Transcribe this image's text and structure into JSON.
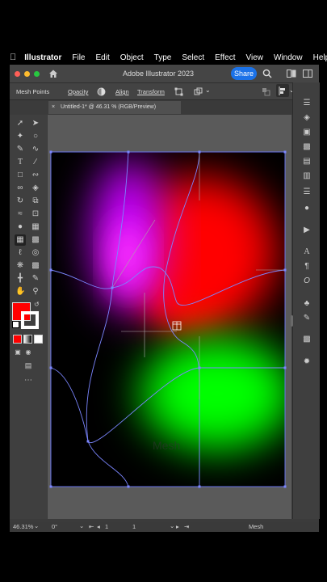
{
  "menubar": {
    "apple_icon": "apple-icon",
    "app_name": "Illustrator",
    "items": [
      "File",
      "Edit",
      "Object",
      "Type",
      "Select",
      "Effect",
      "View",
      "Window",
      "Help"
    ]
  },
  "titlebar": {
    "title": "Adobe Illustrator 2023",
    "share_label": "Share",
    "colors": {
      "close": "#ff5f57",
      "minimize": "#febc2e",
      "maximize": "#28c840",
      "share": "#1b72e8"
    }
  },
  "control_bar": {
    "tool_name": "Mesh Points",
    "opacity_label": "Opacity",
    "align_label": "Align",
    "transform_label": "Transform"
  },
  "document_tab": {
    "close_glyph": "×",
    "title": "Untitled-1* @ 46.31 % (RGB/Preview)"
  },
  "color_swatches": {
    "fill": "#ff0000",
    "stroke": "#ffffff"
  },
  "watermark": "Mesh",
  "status": {
    "zoom": "46.31%",
    "rotation": "0°",
    "artboard_current": "1",
    "artboard_number": "1",
    "tool": "Mesh"
  }
}
